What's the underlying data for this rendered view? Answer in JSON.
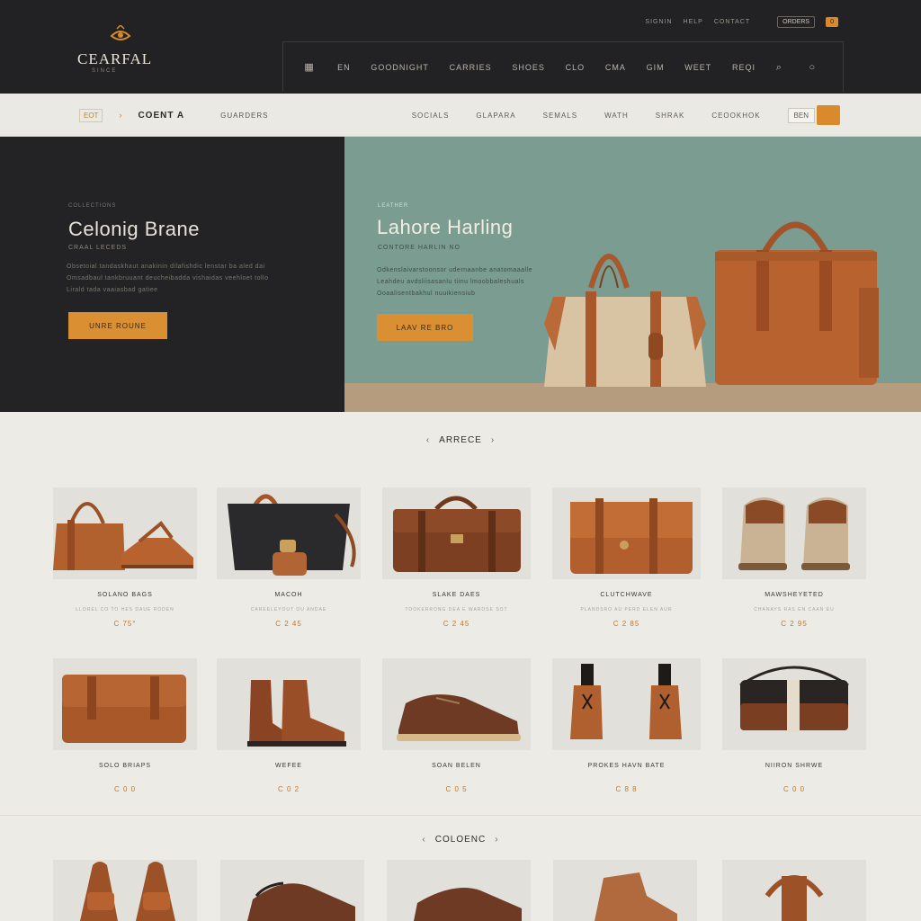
{
  "brand": {
    "name": "CEARFAL",
    "tagline": "SINCE"
  },
  "top_util": {
    "link1": "SIGNIN",
    "link2": "HELP",
    "link3": "CONTACT",
    "button": "ORDERS",
    "badge": "0"
  },
  "main_nav": [
    "EN",
    "GOODNIGHT",
    "CARRIES",
    "SHOES",
    "CLO",
    "CMA",
    "GIM",
    "WEET",
    "REQI"
  ],
  "subbar": {
    "code": "EOT",
    "title": "COENT A",
    "crumb": "GUARDERS",
    "links": [
      "SOCIALS",
      "GLAPARA",
      "SEMALS",
      "WATH",
      "SHRAK",
      "CEOOKHOK"
    ],
    "box": "BEN"
  },
  "hero_left": {
    "kicker": "COLLECTIONS",
    "title": "Celonig Brane",
    "sub": "CRAAL LECEDS",
    "body": [
      "Obsetoial tandaskhaut anakinin dilafishdic lenstar ba aled dai",
      "Omsadbaul tankbruuant deucheibadda vishaidas veehloet tollo",
      "Lirald tada vaaiasbad gatiee"
    ],
    "cta": "UNRE ROUNE"
  },
  "hero_right": {
    "kicker": "LEATHER",
    "title": "Lahore Harling",
    "sub": "CONTORE HARLIN NO",
    "body": [
      "Odkenslaivarstoonsor udernaanbe anatomaaalle",
      "Leahdeu avdsliisasanlu tiinu lmoobbaleshuals",
      "Ooaalisentbakhul nuuikiensiub"
    ],
    "cta": "LAAV RE BRO"
  },
  "section1": "ARRECE",
  "section2": "COLOENC",
  "products": [
    {
      "name": "SOLANO BAGS",
      "meta": "LLOREL CO TO HES DAUE RODEN",
      "price": "C 75°"
    },
    {
      "name": "MACOH",
      "meta": "CAREELEYOUT OU ANDAE",
      "price": "C 2 45"
    },
    {
      "name": "SLAKE DAES",
      "meta": "TOOKERRONG DEA E WAROSE SOT",
      "price": "C 2 45"
    },
    {
      "name": "CLUTCHWAVE",
      "meta": "PLANDSRO AU PERD ELEN AUR",
      "price": "C 2 85"
    },
    {
      "name": "MAWSHEYETED",
      "meta": "CHANAYS RAS EN CAAN EU",
      "price": "C 2 95"
    },
    {
      "name": "SOLO BRIAPS",
      "meta": "",
      "price": "C 0 0"
    },
    {
      "name": "WEFEE",
      "meta": "",
      "price": "C 0 2"
    },
    {
      "name": "SOAN BELEN",
      "meta": "",
      "price": "C 0 5"
    },
    {
      "name": "PROKES HAVN BATE",
      "meta": "",
      "price": "C 8 8"
    },
    {
      "name": "NIIRON SHRWE",
      "meta": "",
      "price": "C 0 0"
    }
  ],
  "colors": {
    "accent": "#d98a2c",
    "dark": "#232325",
    "teal": "#7a9c91",
    "leather": "#a0552a"
  }
}
